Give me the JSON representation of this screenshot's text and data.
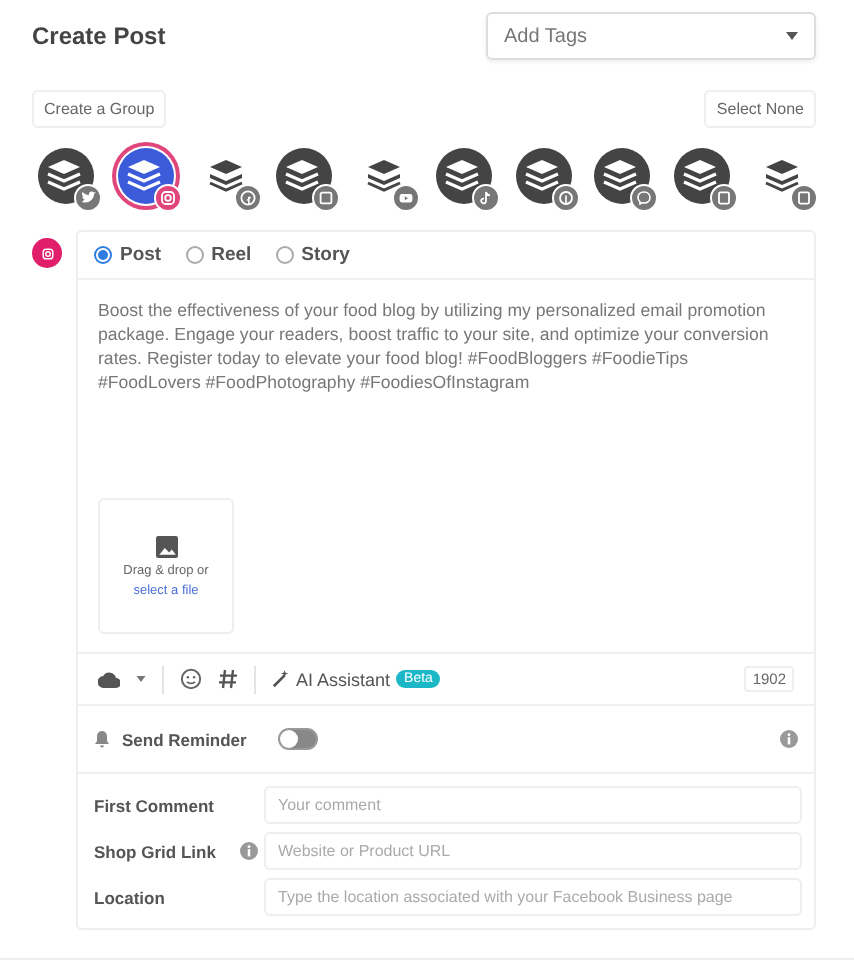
{
  "title": "Create Post",
  "tags_select": {
    "placeholder": "Add Tags"
  },
  "create_group_button": "Create a Group",
  "select_none_button": "Select None",
  "accounts": [
    {
      "kind": "round",
      "badge": {
        "kind": "twitter"
      },
      "selected": false
    },
    {
      "kind": "round",
      "badge": {
        "kind": "instagram"
      },
      "selected": true
    },
    {
      "kind": "stack",
      "badge": {
        "kind": "facebook"
      },
      "selected": false
    },
    {
      "kind": "round",
      "badge": {
        "kind": "linkedin"
      },
      "selected": false
    },
    {
      "kind": "stack",
      "badge": {
        "kind": "youtube"
      },
      "selected": false
    },
    {
      "kind": "round",
      "badge": {
        "kind": "tiktok"
      },
      "selected": false
    },
    {
      "kind": "round",
      "badge": {
        "kind": "pinterest"
      },
      "selected": false
    },
    {
      "kind": "round",
      "badge": {
        "kind": "messenger"
      },
      "selected": false
    },
    {
      "kind": "round",
      "badge": {
        "kind": "business"
      },
      "selected": false
    },
    {
      "kind": "stack",
      "badge": {
        "kind": "business"
      },
      "selected": false
    }
  ],
  "post_types": [
    {
      "label": "Post",
      "selected": true
    },
    {
      "label": "Reel",
      "selected": false
    },
    {
      "label": "Story",
      "selected": false
    }
  ],
  "post_text": "Boost the effectiveness of your food blog by utilizing my personalized email promotion package. Engage your readers, boost traffic to your site, and optimize your conversion rates. Register today to elevate your food blog! #FoodBloggers #FoodieTips #FoodLovers #FoodPhotography #FoodiesOfInstagram",
  "upload": {
    "text": "Drag & drop or",
    "link": "select a file"
  },
  "toolbar": {
    "ai_label": "AI Assistant",
    "ai_badge": "Beta",
    "char_count": "1902"
  },
  "reminder": {
    "label": "Send Reminder",
    "on": false
  },
  "fields": [
    {
      "label": "First Comment",
      "placeholder": "Your comment",
      "info": false
    },
    {
      "label": "Shop Grid Link",
      "placeholder": "Website or Product URL",
      "info": true
    },
    {
      "label": "Location",
      "placeholder": "Type the location associated with your Facebook Business page",
      "info": false
    }
  ]
}
